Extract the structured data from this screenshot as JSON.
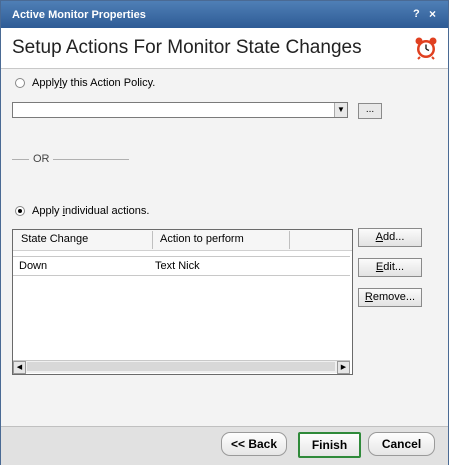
{
  "window": {
    "title": "Active Monitor Properties",
    "help_label": "?",
    "close_label": "×"
  },
  "header": {
    "title": "Setup Actions For Monitor State Changes",
    "icon": "alarm-clock-icon"
  },
  "policy": {
    "radio_label_pre": "Apply",
    "radio_label_ul": "l",
    "radio_label_post": "y this Action Policy.",
    "selected": false,
    "combo_value": "",
    "browse_label": "..."
  },
  "separator": {
    "label": "OR"
  },
  "individual": {
    "radio_label_pre": "Apply ",
    "radio_label_ul": "i",
    "radio_label_post": "ndividual actions.",
    "selected": true
  },
  "actions_list": {
    "columns": [
      "State Change",
      "Action to perform"
    ],
    "rows": [
      {
        "state_change": "Down",
        "action": "Text Nick"
      }
    ]
  },
  "side_buttons": {
    "add": {
      "ul": "A",
      "rest": "dd..."
    },
    "edit": {
      "ul": "E",
      "rest": "dit..."
    },
    "remove": {
      "ul": "R",
      "rest": "emove..."
    }
  },
  "footer": {
    "back_label": "<< Back",
    "finish_label": "Finish",
    "cancel_label": "Cancel"
  },
  "colors": {
    "titlebar": "#3a6aa6",
    "default_button_border": "#2f8a3a",
    "clock_icon": "#e04020"
  }
}
